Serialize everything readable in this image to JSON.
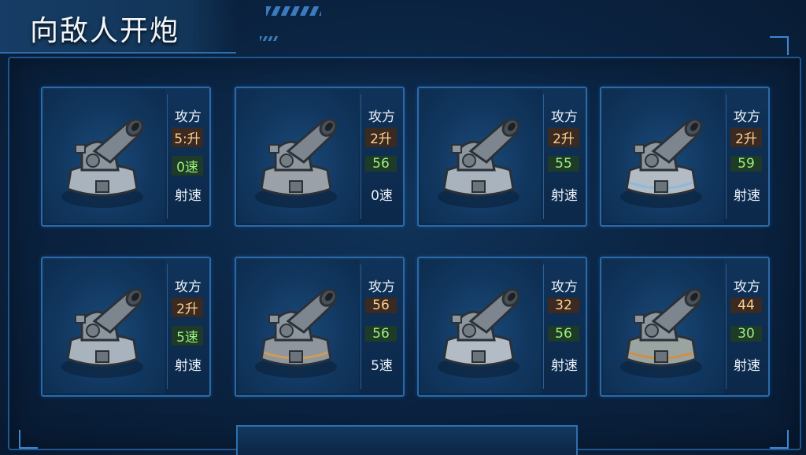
{
  "title": "向敌人开炮",
  "cards": [
    {
      "attack_label": "攻方",
      "val1": "5:升",
      "val2": "0速",
      "rate_label": "射速",
      "base": "#a9b3bd",
      "accent": "none"
    },
    {
      "attack_label": "攻方",
      "val1": "2升",
      "val2": "56",
      "rate_label": "0速",
      "base": "#9aa1a8",
      "accent": "none"
    },
    {
      "attack_label": "攻方",
      "val1": "2升",
      "val2": "55",
      "rate_label": "射速",
      "base": "#a9b3bd",
      "accent": "none"
    },
    {
      "attack_label": "攻方",
      "val1": "2升",
      "val2": "59",
      "rate_label": "射速",
      "base": "#b3bcc4",
      "accent": "#7fb8e6"
    },
    {
      "attack_label": "攻方",
      "val1": "2升",
      "val2": "5速",
      "rate_label": "射速",
      "base": "#a9b3bd",
      "accent": "none"
    },
    {
      "attack_label": "攻方",
      "val1": "56",
      "val2": "56",
      "rate_label": "5速",
      "base": "#8f969d",
      "accent": "#e0a040"
    },
    {
      "attack_label": "攻方",
      "val1": "32",
      "val2": "56",
      "rate_label": "射速",
      "base": "#b3bcc4",
      "accent": "none"
    },
    {
      "attack_label": "攻方",
      "val1": "44",
      "val2": "30",
      "rate_label": "射速",
      "base": "#9aa4a0",
      "accent": "#e08a2c"
    }
  ],
  "colors": {
    "accent": "#2f6fae",
    "attack_value": "#ffce8a",
    "speed_value": "#9cf07c"
  },
  "icons": {
    "cannon": "cannon-turret-icon"
  }
}
